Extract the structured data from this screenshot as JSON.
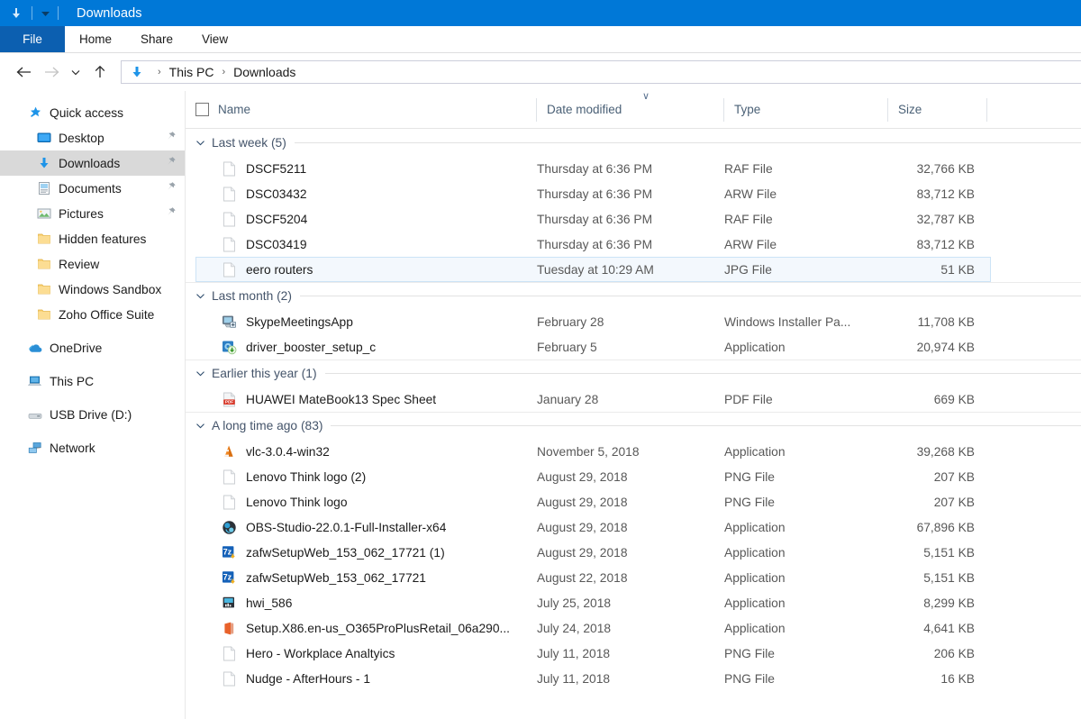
{
  "titlebar": {
    "download_icon": "download-arrow-icon",
    "customize_icon": "chevron-down-icon",
    "title": "Downloads"
  },
  "ribbon": {
    "tabs": [
      {
        "label": "File",
        "active": true
      },
      {
        "label": "Home",
        "active": false
      },
      {
        "label": "Share",
        "active": false
      },
      {
        "label": "View",
        "active": false
      }
    ]
  },
  "navbar": {
    "back_icon": "back-arrow-icon",
    "forward_icon": "forward-arrow-icon",
    "recent_icon": "recent-locations-chevron-icon",
    "up_icon": "up-arrow-icon",
    "address_icon": "downloads-folder-icon",
    "breadcrumbs": [
      "This PC",
      "Downloads"
    ],
    "separator": "›"
  },
  "sidebar": {
    "items": [
      {
        "label": "Quick access",
        "icon": "star-icon",
        "indent": 0,
        "pinned": false,
        "selected": false
      },
      {
        "label": "Desktop",
        "icon": "desktop-icon",
        "indent": 1,
        "pinned": true,
        "selected": false
      },
      {
        "label": "Downloads",
        "icon": "download-arrow-icon",
        "indent": 1,
        "pinned": true,
        "selected": true
      },
      {
        "label": "Documents",
        "icon": "documents-icon",
        "indent": 1,
        "pinned": true,
        "selected": false
      },
      {
        "label": "Pictures",
        "icon": "pictures-icon",
        "indent": 1,
        "pinned": true,
        "selected": false
      },
      {
        "label": "Hidden features",
        "icon": "folder-icon",
        "indent": 1,
        "pinned": false,
        "selected": false
      },
      {
        "label": "Review",
        "icon": "folder-icon",
        "indent": 1,
        "pinned": false,
        "selected": false
      },
      {
        "label": "Windows Sandbox",
        "icon": "folder-icon",
        "indent": 1,
        "pinned": false,
        "selected": false
      },
      {
        "label": "Zoho Office Suite",
        "icon": "folder-icon",
        "indent": 1,
        "pinned": false,
        "selected": false
      },
      {
        "label": "OneDrive",
        "icon": "onedrive-cloud-icon",
        "indent": 0,
        "pinned": false,
        "selected": false,
        "gap_before": true
      },
      {
        "label": "This PC",
        "icon": "this-pc-icon",
        "indent": 0,
        "pinned": false,
        "selected": false,
        "gap_before": true
      },
      {
        "label": "USB Drive (D:)",
        "icon": "usb-drive-icon",
        "indent": 0,
        "pinned": false,
        "selected": false,
        "gap_before": true
      },
      {
        "label": "Network",
        "icon": "network-icon",
        "indent": 0,
        "pinned": false,
        "selected": false,
        "gap_before": true
      }
    ]
  },
  "columns": {
    "select_all_checkbox": "select-all-checkbox",
    "name": "Name",
    "date_modified": "Date modified",
    "type": "Type",
    "size": "Size",
    "sort_indicator": "∨"
  },
  "groups": [
    {
      "label": "Last week (5)",
      "files": [
        {
          "name": "DSCF5211",
          "date": "Thursday at 6:36 PM",
          "type": "RAF File",
          "size": "32,766 KB",
          "icon": "generic-file-icon",
          "selected": false
        },
        {
          "name": "DSC03432",
          "date": "Thursday at 6:36 PM",
          "type": "ARW File",
          "size": "83,712 KB",
          "icon": "generic-file-icon",
          "selected": false
        },
        {
          "name": "DSCF5204",
          "date": "Thursday at 6:36 PM",
          "type": "RAF File",
          "size": "32,787 KB",
          "icon": "generic-file-icon",
          "selected": false
        },
        {
          "name": "DSC03419",
          "date": "Thursday at 6:36 PM",
          "type": "ARW File",
          "size": "83,712 KB",
          "icon": "generic-file-icon",
          "selected": false
        },
        {
          "name": "eero routers",
          "date": "Tuesday at 10:29 AM",
          "type": "JPG File",
          "size": "51 KB",
          "icon": "generic-file-icon",
          "selected": true
        }
      ]
    },
    {
      "label": "Last month (2)",
      "files": [
        {
          "name": "SkypeMeetingsApp",
          "date": "February 28",
          "type": "Windows Installer Pa...",
          "size": "11,708 KB",
          "icon": "windows-installer-icon",
          "selected": false
        },
        {
          "name": "driver_booster_setup_c",
          "date": "February 5",
          "type": "Application",
          "size": "20,974 KB",
          "icon": "driver-booster-icon",
          "selected": false
        }
      ]
    },
    {
      "label": "Earlier this year (1)",
      "files": [
        {
          "name": "HUAWEI MateBook13 Spec Sheet",
          "date": "January 28",
          "type": "PDF File",
          "size": "669 KB",
          "icon": "pdf-file-icon",
          "selected": false
        }
      ]
    },
    {
      "label": "A long time ago (83)",
      "files": [
        {
          "name": "vlc-3.0.4-win32",
          "date": "November 5, 2018",
          "type": "Application",
          "size": "39,268 KB",
          "icon": "vlc-cone-icon",
          "selected": false
        },
        {
          "name": "Lenovo Think logo (2)",
          "date": "August 29, 2018",
          "type": "PNG File",
          "size": "207 KB",
          "icon": "generic-file-icon",
          "selected": false
        },
        {
          "name": "Lenovo Think logo",
          "date": "August 29, 2018",
          "type": "PNG File",
          "size": "207 KB",
          "icon": "generic-file-icon",
          "selected": false
        },
        {
          "name": "OBS-Studio-22.0.1-Full-Installer-x64",
          "date": "August 29, 2018",
          "type": "Application",
          "size": "67,896 KB",
          "icon": "obs-studio-icon",
          "selected": false
        },
        {
          "name": "zafwSetupWeb_153_062_17721 (1)",
          "date": "August 29, 2018",
          "type": "Application",
          "size": "5,151 KB",
          "icon": "sevenzip-icon",
          "selected": false
        },
        {
          "name": "zafwSetupWeb_153_062_17721",
          "date": "August 22, 2018",
          "type": "Application",
          "size": "5,151 KB",
          "icon": "sevenzip-icon",
          "selected": false
        },
        {
          "name": "hwi_586",
          "date": "July 25, 2018",
          "type": "Application",
          "size": "8,299 KB",
          "icon": "hwi-app-icon",
          "selected": false
        },
        {
          "name": "Setup.X86.en-us_O365ProPlusRetail_06a290...",
          "date": "July 24, 2018",
          "type": "Application",
          "size": "4,641 KB",
          "icon": "office-setup-icon",
          "selected": false
        },
        {
          "name": "Hero - Workplace Analtyics",
          "date": "July 11, 2018",
          "type": "PNG File",
          "size": "206 KB",
          "icon": "generic-file-icon",
          "selected": false
        },
        {
          "name": "Nudge - AfterHours - 1",
          "date": "July 11, 2018",
          "type": "PNG File",
          "size": "16 KB",
          "icon": "generic-file-icon",
          "selected": false
        }
      ]
    }
  ],
  "colors": {
    "titlebar_blue": "#0078d7",
    "file_tab_blue": "#0c5fb0",
    "selection_fill": "#f3f8fd",
    "selection_border": "#cce3f6",
    "sidebar_selected": "#d9d9d9",
    "group_label": "#44546a",
    "secondary_text": "#585858"
  }
}
